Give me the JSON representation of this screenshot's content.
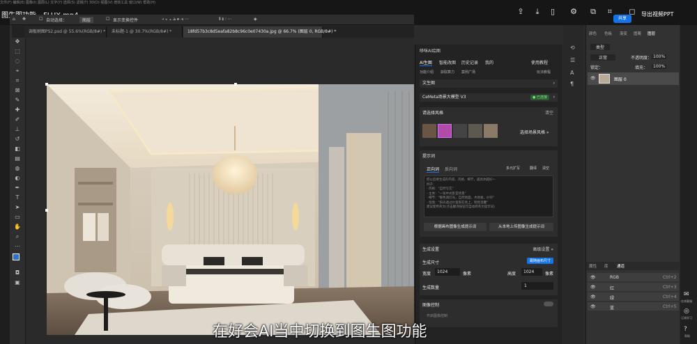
{
  "window": {
    "title": "图生图功能、FLUX.mp4",
    "menu": "文件(F) 编辑(E) 图像(I) 图层(L) 文字(Y) 选择(S) 滤镜(T) 3D(D) 视图(V) 增效工具 窗口(W) 帮助(H)",
    "share_label": "共享",
    "export_label": "导出视频PPT"
  },
  "options_bar": {
    "auto_select": "自动选择：",
    "layer_select": "图层",
    "show_transform": "显示变换控件"
  },
  "tabs": [
    {
      "label": "调板刷图PS2.psd @ 55.6%(RGB/8#) *"
    },
    {
      "label": "未标题-1 @ 30.7%(RGB/8#) *"
    },
    {
      "label": "18fd57b3c8d5eafa82b8c96c0e07430a.jpg @ 66.7% (图层 0, RGB/8#) *"
    }
  ],
  "ai_panel": {
    "title": "哆咪AI绘图",
    "nav": [
      "AI生图",
      "智能改图",
      "历史记录",
      "我的"
    ],
    "help": "使用教程",
    "sub_nav": [
      "功能介绍",
      "获取算力",
      "案例广场"
    ],
    "guide": "玩法教程",
    "mode": "文生图",
    "model": "CeMeta场景大模型 V3",
    "model_badge": "● 已连接",
    "style_section": "请选择风格",
    "style_clear": "清空",
    "style_select": "选择场景风格 »",
    "prompt_section": "提示词",
    "prompt_tabs": [
      "正向词",
      "反向词"
    ],
    "prompt_tools": [
      "多元扩写",
      "翻译",
      "清空"
    ],
    "prompt_placeholder": "把以后要生成的内容、风格、细节，越具体越好～\n例子：\n- 风格：\"自然写实\"\n- 主体：\"一张中式卧室场景\"\n- 细节：\"暖色调灯光，自然地面，木地板，纱帘\"\n- 氛围：\"阳光透过纱窗照在地上，明亮温馨\"\n建议使用英文(点击翻译按钮可自动转英文提示词)",
    "btn_canvas_prompt": "根据画布图像生成提示词",
    "btn_local_prompt": "从本地上传图像生成提示词",
    "gen_section": "生成设置",
    "gen_advanced": "高级设置 »",
    "size_label": "生成尺寸",
    "size_btn": "跟随画布尺寸",
    "width_label": "宽度",
    "width_value": "1024",
    "height_label": "高度",
    "height_value": "1024",
    "unit": "像素",
    "count_label": "生成数量",
    "count_value": "1",
    "img_control": "图像控制",
    "toggle_label": "开启图像控制"
  },
  "layers_panel": {
    "top_tabs": [
      "颜色",
      "色板",
      "渐变",
      "图案",
      "图层"
    ],
    "kind": "类型",
    "blend": "正常",
    "opacity_label": "不透明度：",
    "opacity_value": "100%",
    "lock_label": "锁定：",
    "fill_label": "填充：",
    "fill_value": "100%",
    "layer_name": "图层 0",
    "channel_tabs": [
      "属性",
      "库",
      "通道"
    ],
    "channels": [
      {
        "name": "RGB",
        "shortcut": "Ctrl+2"
      },
      {
        "name": "红",
        "shortcut": "Ctrl+3"
      },
      {
        "name": "绿",
        "shortcut": "Ctrl+4"
      },
      {
        "name": "蓝",
        "shortcut": "Ctrl+5"
      }
    ]
  },
  "side_actions": [
    "在线客服",
    "订阅学习",
    "帮助"
  ],
  "subtitle": "在好会AI当中切换到图生图功能"
}
